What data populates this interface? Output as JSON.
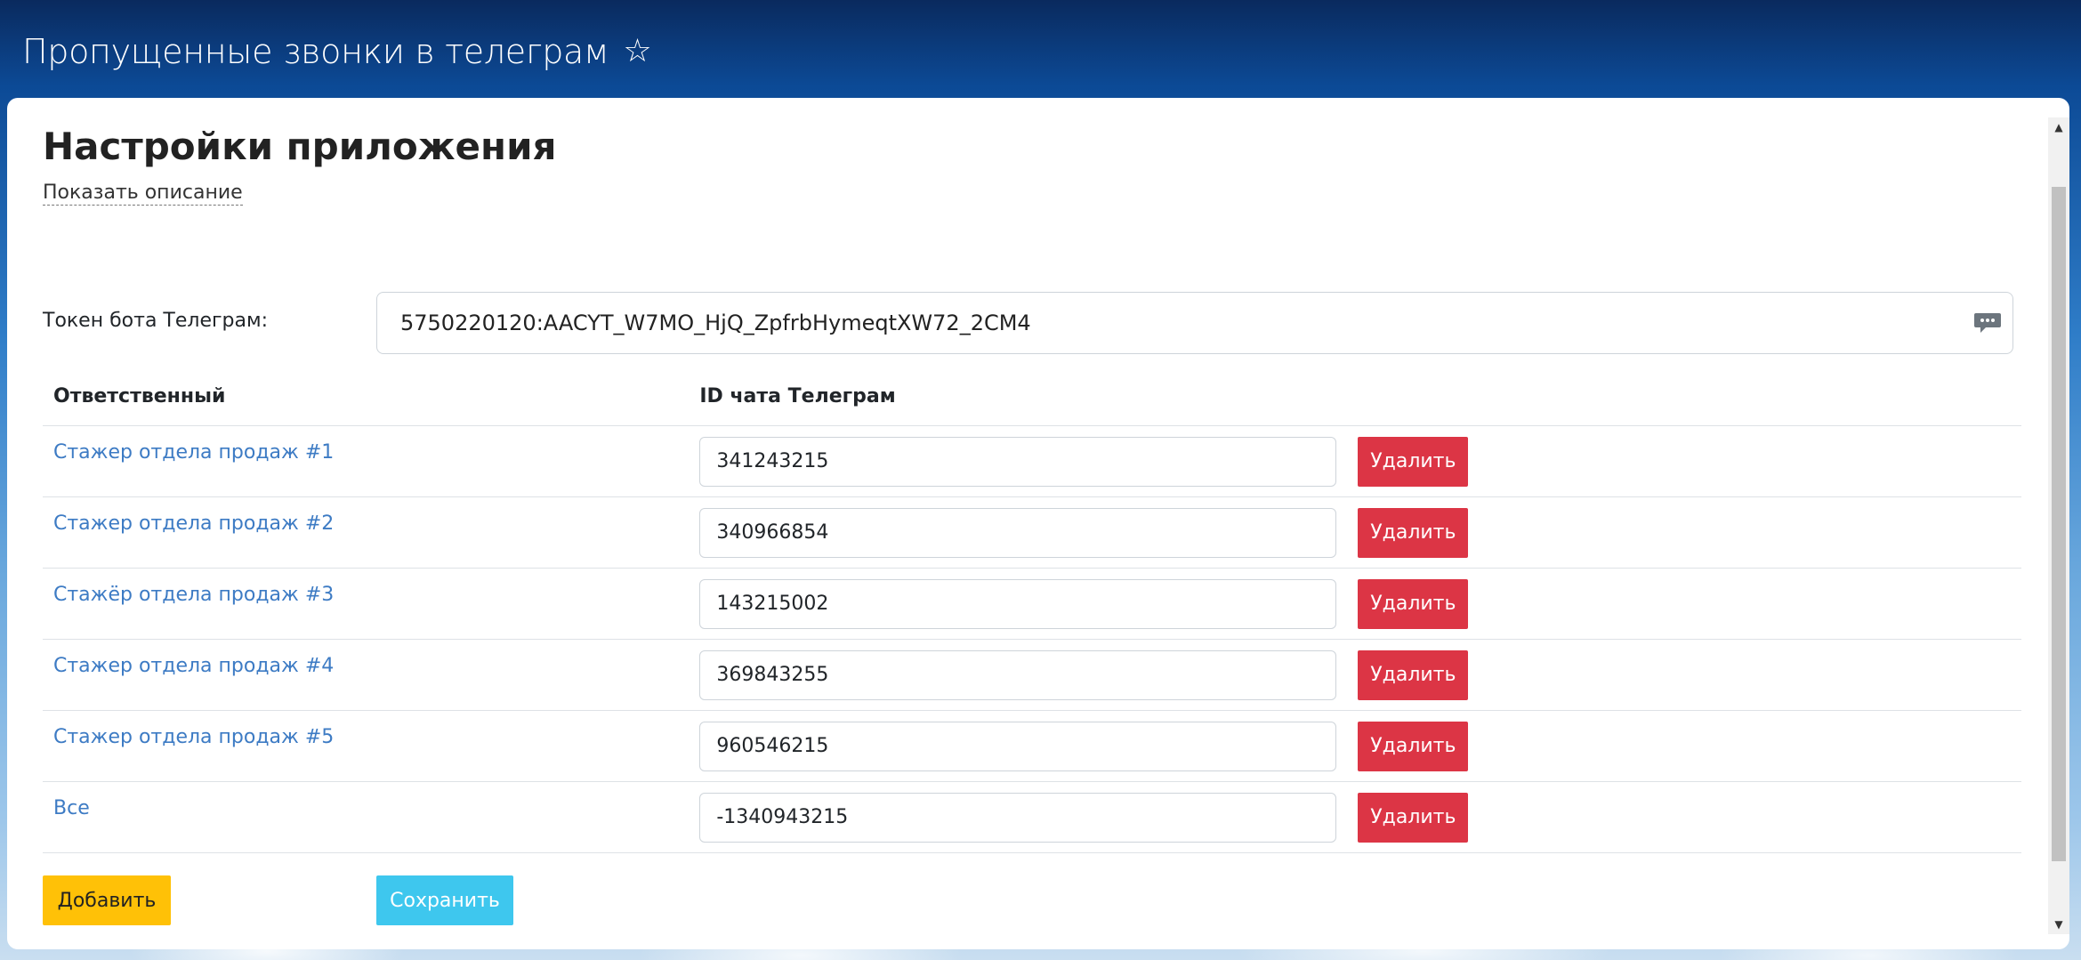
{
  "window": {
    "title": "Пропущенные звонки в телеграм",
    "favorite_icon": "star-outline-icon"
  },
  "settings": {
    "heading": "Настройки приложения",
    "show_description": "Показать описание",
    "token_label": "Токен бота Телеграм:",
    "token_value": "5750220120:AACYT_W7MO_HjQ_ZpfrbHymeqtXW72_2CM4",
    "token_icon": "comment-icon"
  },
  "table": {
    "headers": {
      "responsible": "Ответственный",
      "chat_id": "ID чата Телеграм"
    },
    "rows": [
      {
        "name": "Стажер отдела продаж #1",
        "chat_id": "341243215",
        "delete_label": "Удалить"
      },
      {
        "name": "Стажер отдела продаж #2",
        "chat_id": "340966854",
        "delete_label": "Удалить"
      },
      {
        "name": "Стажёр отдела продаж #3",
        "chat_id": "143215002",
        "delete_label": "Удалить"
      },
      {
        "name": "Стажер отдела продаж #4",
        "chat_id": "369843255",
        "delete_label": "Удалить"
      },
      {
        "name": "Стажер отдела продаж #5",
        "chat_id": "960546215",
        "delete_label": "Удалить"
      },
      {
        "name": "Все",
        "chat_id": "-1340943215",
        "delete_label": "Удалить"
      }
    ]
  },
  "actions": {
    "add_label": "Добавить",
    "save_label": "Сохранить"
  },
  "colors": {
    "delete": "#dc3545",
    "add": "#ffc107",
    "save": "#3ec7ee",
    "link": "#3d7bc4"
  }
}
